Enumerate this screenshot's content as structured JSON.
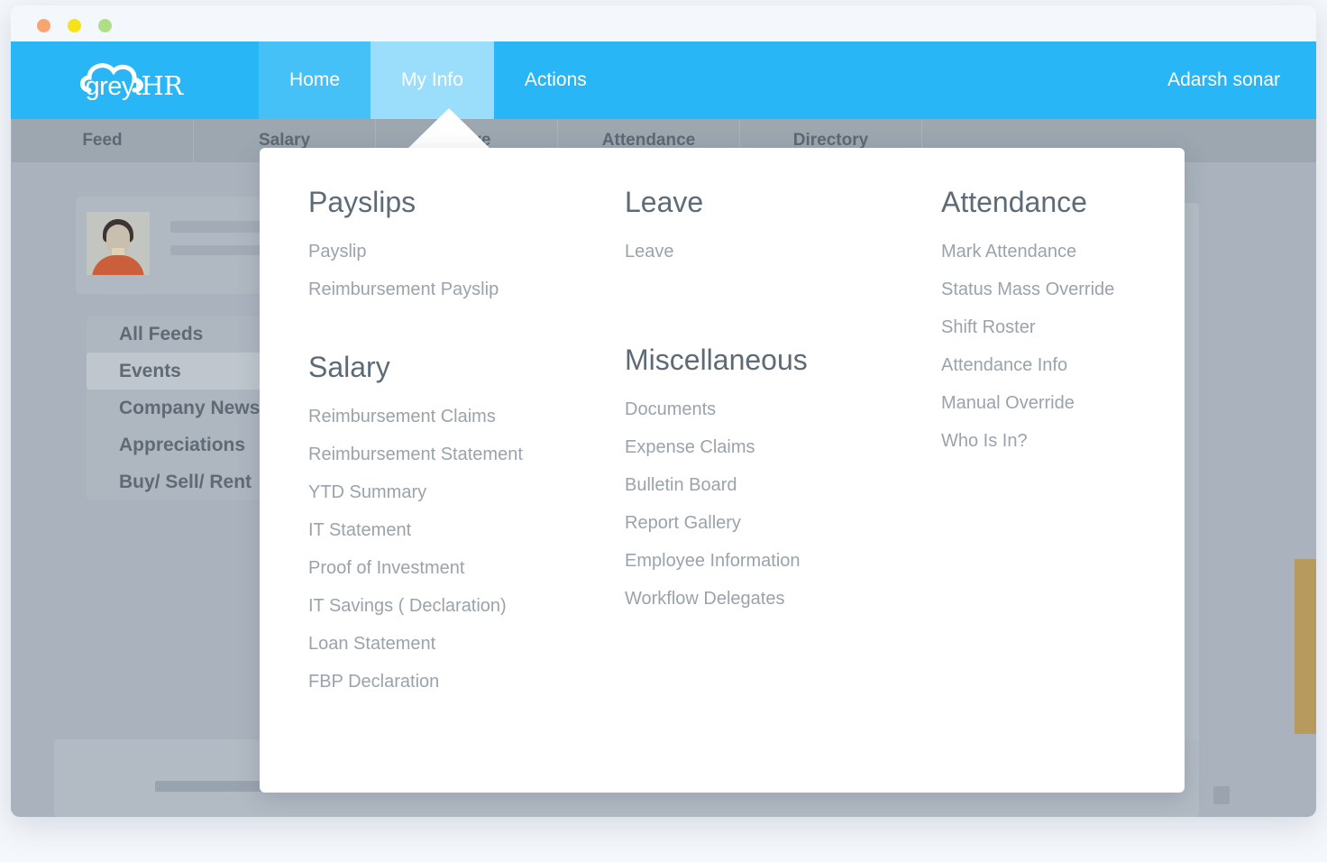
{
  "window": {
    "traffic_lights": [
      "close",
      "minimize",
      "maximize"
    ]
  },
  "brand": {
    "logo_text_part1": "greyt",
    "logo_text_part2": "HR",
    "logo_icon": "cloud-icon",
    "accent_blue": "#29b6f6",
    "tab_blue": "#46c1f7",
    "active_tab_blue": "#9adefb"
  },
  "topnav": {
    "tabs": [
      {
        "label": "Home",
        "active": false
      },
      {
        "label": "My Info",
        "active": true
      },
      {
        "label": "Actions",
        "active": false
      }
    ],
    "user": "Adarsh sonar"
  },
  "subnav": {
    "tabs": [
      {
        "label": "Feed"
      },
      {
        "label": "Salary"
      },
      {
        "label": "Leave"
      },
      {
        "label": "Attendance"
      },
      {
        "label": "Directory"
      }
    ]
  },
  "sidebar": {
    "items": [
      {
        "label": "All Feeds",
        "selected": false
      },
      {
        "label": "Events",
        "selected": true
      },
      {
        "label": "Company News",
        "selected": false
      },
      {
        "label": "Appreciations",
        "selected": false
      },
      {
        "label": "Buy/ Sell/ Rent",
        "selected": false
      }
    ]
  },
  "dropdown": {
    "columns": [
      {
        "groups": [
          {
            "heading": "Payslips",
            "links": [
              "Payslip",
              "Reimbursement Payslip"
            ]
          },
          {
            "heading": "Salary",
            "links": [
              "Reimbursement Claims",
              "Reimbursement Statement",
              "YTD Summary",
              "IT Statement",
              "Proof of Investment",
              "IT Savings ( Declaration)",
              "Loan Statement",
              "FBP Declaration"
            ]
          }
        ]
      },
      {
        "groups": [
          {
            "heading": "Leave",
            "links": [
              "Leave"
            ]
          },
          {
            "heading": "Miscellaneous",
            "links": [
              "Documents",
              "Expense Claims",
              "Bulletin Board",
              "Report Gallery",
              "Employee Information",
              "Workflow Delegates"
            ]
          }
        ]
      },
      {
        "groups": [
          {
            "heading": "Attendance",
            "links": [
              "Mark Attendance",
              "Status Mass Override",
              "Shift Roster",
              "Attendance Info",
              "Manual Override",
              "Who Is In?"
            ]
          }
        ]
      }
    ]
  },
  "colors": {
    "page_grey": "#aab3bd",
    "card_grey": "#b2bac3",
    "subnav_grey": "#9ca7b0",
    "gold_accent": "#b79a5d",
    "heading_text": "#5d6b77",
    "link_text": "#9aa3ab"
  }
}
